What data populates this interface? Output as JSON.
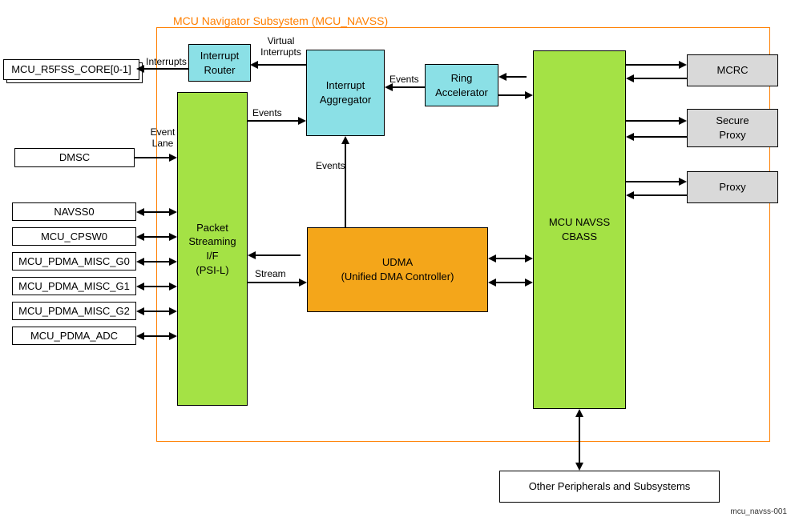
{
  "diagram": {
    "title": "MCU Navigator Subsystem (MCU_NAVSS)",
    "figref": "mcu_navss-001",
    "blocks": {
      "r5": "MCU_R5FSS_CORE[0-1]",
      "dmsc": "DMSC",
      "navss0": "NAVSS0",
      "cpsw": "MCU_CPSW0",
      "pdma_g0": "MCU_PDMA_MISC_G0",
      "pdma_g1": "MCU_PDMA_MISC_G1",
      "pdma_g2": "MCU_PDMA_MISC_G2",
      "pdma_adc": "MCU_PDMA_ADC",
      "psil": "Packet\nStreaming\nI/F\n(PSI-L)",
      "int_router": "Interrupt\nRouter",
      "int_aggr": "Interrupt\nAggregator",
      "ring_acc": "Ring\nAccelerator",
      "udma": "UDMA\n(Unified DMA Controller)",
      "cbass": "MCU NAVSS\nCBASS",
      "mcrc": "MCRC",
      "secure_proxy": "Secure\nProxy",
      "proxy": "Proxy",
      "other": "Other Peripherals and Subsystems"
    },
    "labels": {
      "interrupts1": "Interrupts",
      "interrupts2": "Virtual\nInterrupts",
      "events1": "Events",
      "events2": "Events",
      "events3": "Events",
      "event_lane": "Event\nLane",
      "stream": "Stream"
    }
  },
  "chart_data": {
    "type": "block-diagram",
    "container": {
      "name": "MCU_NAVSS",
      "title": "MCU Navigator Subsystem (MCU_NAVSS)"
    },
    "nodes": [
      {
        "id": "r5",
        "label": "MCU_R5FSS_CORE[0-1]",
        "kind": "external"
      },
      {
        "id": "dmsc",
        "label": "DMSC",
        "kind": "external"
      },
      {
        "id": "navss0",
        "label": "NAVSS0",
        "kind": "external"
      },
      {
        "id": "cpsw",
        "label": "MCU_CPSW0",
        "kind": "external"
      },
      {
        "id": "pdma_g0",
        "label": "MCU_PDMA_MISC_G0",
        "kind": "external"
      },
      {
        "id": "pdma_g1",
        "label": "MCU_PDMA_MISC_G1",
        "kind": "external"
      },
      {
        "id": "pdma_g2",
        "label": "MCU_PDMA_MISC_G2",
        "kind": "external"
      },
      {
        "id": "pdma_adc",
        "label": "MCU_PDMA_ADC",
        "kind": "external"
      },
      {
        "id": "psil",
        "label": "Packet Streaming I/F (PSI-L)",
        "kind": "navss"
      },
      {
        "id": "int_router",
        "label": "Interrupt Router",
        "kind": "navss"
      },
      {
        "id": "int_aggr",
        "label": "Interrupt Aggregator",
        "kind": "navss"
      },
      {
        "id": "ring_acc",
        "label": "Ring Accelerator",
        "kind": "navss"
      },
      {
        "id": "udma",
        "label": "UDMA (Unified DMA Controller)",
        "kind": "navss"
      },
      {
        "id": "cbass",
        "label": "MCU NAVSS CBASS",
        "kind": "navss"
      },
      {
        "id": "mcrc",
        "label": "MCRC",
        "kind": "peripheral"
      },
      {
        "id": "secure_proxy",
        "label": "Secure Proxy",
        "kind": "peripheral"
      },
      {
        "id": "proxy",
        "label": "Proxy",
        "kind": "peripheral"
      },
      {
        "id": "other",
        "label": "Other Peripherals and Subsystems",
        "kind": "external"
      }
    ],
    "edges": [
      {
        "from": "int_router",
        "to": "r5",
        "label": "Interrupts",
        "dir": "one"
      },
      {
        "from": "int_aggr",
        "to": "int_router",
        "label": "Virtual Interrupts",
        "dir": "one"
      },
      {
        "from": "psil",
        "to": "int_aggr",
        "label": "Events",
        "dir": "one"
      },
      {
        "from": "udma",
        "to": "int_aggr",
        "label": "Events",
        "dir": "one"
      },
      {
        "from": "ring_acc",
        "to": "int_aggr",
        "label": "Events",
        "dir": "one"
      },
      {
        "from": "dmsc",
        "to": "psil",
        "label": "Event Lane",
        "dir": "one"
      },
      {
        "from": "navss0",
        "to": "psil",
        "dir": "both"
      },
      {
        "from": "cpsw",
        "to": "psil",
        "dir": "both"
      },
      {
        "from": "pdma_g0",
        "to": "psil",
        "dir": "both"
      },
      {
        "from": "pdma_g1",
        "to": "psil",
        "dir": "both"
      },
      {
        "from": "pdma_g2",
        "to": "psil",
        "dir": "both"
      },
      {
        "from": "pdma_adc",
        "to": "psil",
        "dir": "both"
      },
      {
        "from": "psil",
        "to": "udma",
        "label": "Stream",
        "dir": "both"
      },
      {
        "from": "udma",
        "to": "cbass",
        "dir": "both",
        "multi": 2
      },
      {
        "from": "cbass",
        "to": "ring_acc",
        "dir": "both"
      },
      {
        "from": "cbass",
        "to": "mcrc",
        "dir": "both"
      },
      {
        "from": "cbass",
        "to": "secure_proxy",
        "dir": "both"
      },
      {
        "from": "cbass",
        "to": "proxy",
        "dir": "both"
      },
      {
        "from": "cbass",
        "to": "other",
        "dir": "both"
      }
    ]
  }
}
